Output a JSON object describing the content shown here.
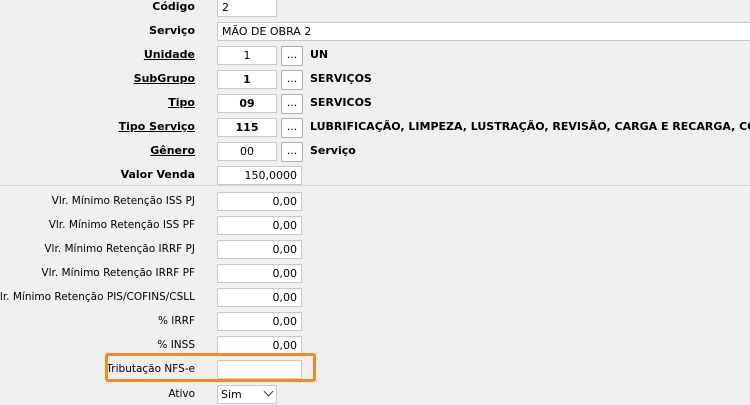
{
  "fields": {
    "codigo": {
      "label": "Código",
      "value": "2"
    },
    "servico": {
      "label": "Serviço",
      "value": "MÃO DE OBRA 2"
    },
    "unidade": {
      "label": "Unidade",
      "value": "1",
      "button": "...",
      "description": "UN"
    },
    "subgrupo": {
      "label": "SubGrupo",
      "value": "1",
      "button": "...",
      "description": "SERVIÇOS"
    },
    "tipo": {
      "label": "Tipo",
      "value": "09",
      "button": "...",
      "description": "SERVICOS"
    },
    "tipo_servico": {
      "label": "Tipo Serviço",
      "value": "115",
      "button": "...",
      "description": "LUBRIFICAÇÃO, LIMPEZA, LUSTRAÇÃO, REVISÃO, CARGA E RECARGA, CONSERTO,"
    },
    "genero": {
      "label": "Gênero",
      "value": "00",
      "button": "...",
      "description": "Serviço"
    },
    "valor_venda": {
      "label": "Valor Venda",
      "value": "150,0000"
    }
  },
  "retention": [
    {
      "label": "Vlr. Mínimo Retenção ISS PJ",
      "value": "0,00"
    },
    {
      "label": "Vlr. Mínimo Retenção ISS PF",
      "value": "0,00"
    },
    {
      "label": "Vlr. Mínimo Retenção IRRF PJ",
      "value": "0,00"
    },
    {
      "label": "Vlr. Mínimo Retenção IRRF PF",
      "value": "0,00"
    },
    {
      "label": "Vlr. Mínimo Retenção PIS/COFINS/CSLL",
      "value": "0,00"
    },
    {
      "label": "% IRRF",
      "value": "0,00"
    },
    {
      "label": "% INSS",
      "value": "0,00"
    }
  ],
  "tributacao": {
    "label": "Tributação NFS-e",
    "value": ""
  },
  "ativo": {
    "label": "Ativo",
    "selected": "Sim"
  },
  "colors": {
    "highlight": "#f5891f",
    "background": "#f0f0f0"
  }
}
